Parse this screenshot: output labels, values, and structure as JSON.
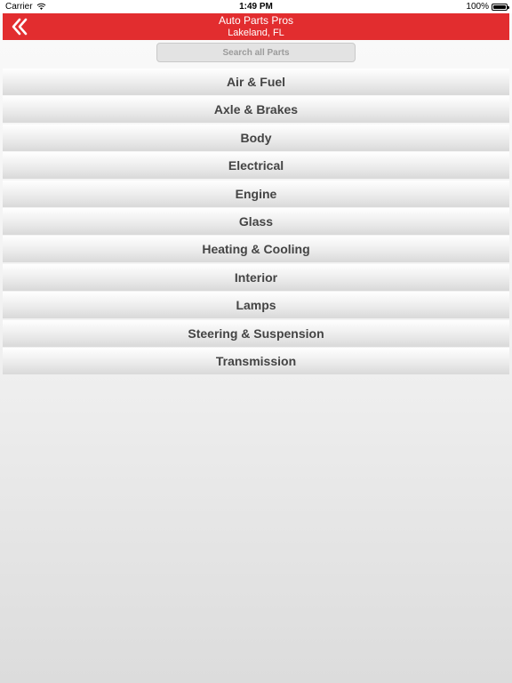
{
  "status_bar": {
    "carrier": "Carrier",
    "time": "1:49 PM",
    "battery": "100%",
    "battery_level": 1.0
  },
  "header": {
    "title": "Auto Parts Pros",
    "subtitle": "Lakeland, FL",
    "back_icon": "double-chevron-left-icon",
    "background_color": "#e22d2f"
  },
  "search": {
    "placeholder": "Search all Parts",
    "value": ""
  },
  "categories": [
    {
      "label": "Air & Fuel"
    },
    {
      "label": "Axle & Brakes"
    },
    {
      "label": "Body"
    },
    {
      "label": "Electrical"
    },
    {
      "label": "Engine"
    },
    {
      "label": "Glass"
    },
    {
      "label": "Heating & Cooling"
    },
    {
      "label": "Interior"
    },
    {
      "label": "Lamps"
    },
    {
      "label": "Steering & Suspension"
    },
    {
      "label": "Transmission"
    }
  ]
}
